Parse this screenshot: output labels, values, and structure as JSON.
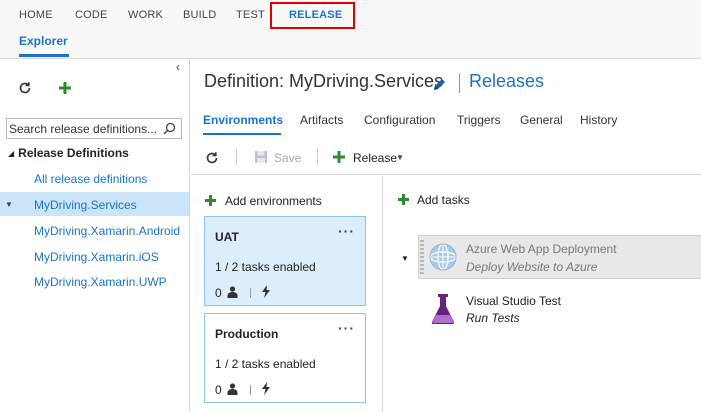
{
  "topnav": {
    "items": [
      "HOME",
      "CODE",
      "WORK",
      "BUILD",
      "TEST",
      "RELEASE"
    ],
    "active": "RELEASE"
  },
  "subnav": {
    "explorer": "Explorer"
  },
  "left": {
    "search_placeholder": "Search release definitions...",
    "tree_header": "Release Definitions",
    "items": [
      "All release definitions",
      "MyDriving.Services",
      "MyDriving.Xamarin.Android",
      "MyDriving.Xamarin.iOS",
      "MyDriving.Xamarin.UWP"
    ],
    "selected": "MyDriving.Services"
  },
  "main": {
    "title": "Definition: MyDriving.Services",
    "releases_link": "Releases",
    "tabs": [
      "Environments",
      "Artifacts",
      "Configuration",
      "Triggers",
      "General",
      "History"
    ],
    "active_tab": "Environments",
    "toolbar": {
      "save": "Save",
      "release": "Release"
    },
    "add_environments": "Add environments",
    "environments": [
      {
        "name": "UAT",
        "tasks": "1 / 2 tasks enabled",
        "approvers": "0"
      },
      {
        "name": "Production",
        "tasks": "1 / 2 tasks enabled",
        "approvers": "0"
      }
    ],
    "add_tasks": "Add tasks",
    "tasks": [
      {
        "title": "Azure Web App Deployment",
        "subtitle": "Deploy Website to Azure",
        "enabled": false
      },
      {
        "title": "Visual Studio Test",
        "subtitle": "Run Tests",
        "enabled": true
      }
    ]
  },
  "colors": {
    "accent": "#1a73c7",
    "highlight_box": "#e00000",
    "selected_bg": "#cce4f7",
    "add_green": "#2e8b2e"
  }
}
